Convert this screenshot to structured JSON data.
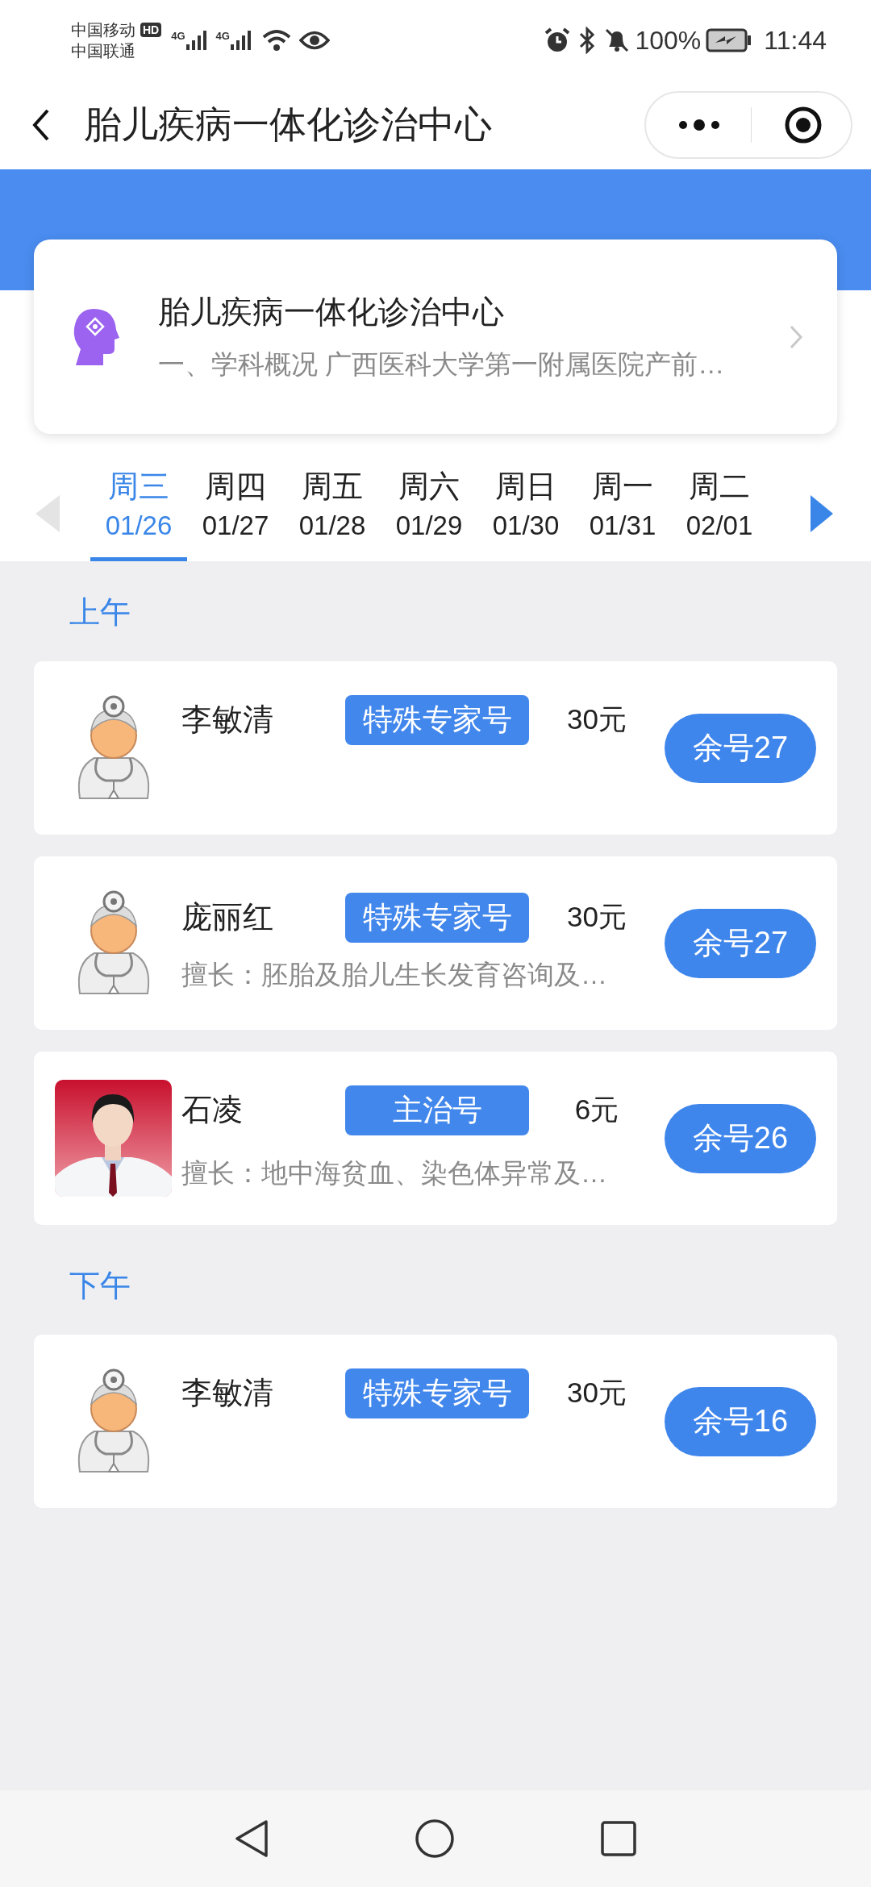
{
  "status_bar": {
    "carriers": [
      "中国移动",
      "中国联通"
    ],
    "hd_badge": "HD",
    "network_labels": [
      "4G",
      "4G"
    ],
    "battery": "100%",
    "time": "11:44"
  },
  "nav_bar": {
    "title": "胎儿疾病一体化诊治中心"
  },
  "department_card": {
    "title": "胎儿疾病一体化诊治中心",
    "description": "一、学科概况 广西医科大学第一附属医院产前…"
  },
  "days": [
    {
      "weekday": "周三",
      "date": "01/26",
      "selected": true
    },
    {
      "weekday": "周四",
      "date": "01/27",
      "selected": false
    },
    {
      "weekday": "周五",
      "date": "01/28",
      "selected": false
    },
    {
      "weekday": "周六",
      "date": "01/29",
      "selected": false
    },
    {
      "weekday": "周日",
      "date": "01/30",
      "selected": false
    },
    {
      "weekday": "周一",
      "date": "01/31",
      "selected": false
    },
    {
      "weekday": "周二",
      "date": "02/01",
      "selected": false
    }
  ],
  "sections": [
    {
      "label": "上午",
      "doctors": [
        {
          "kind": "avatar",
          "name": "李敏清",
          "tag": "特殊专家号",
          "price": "30元",
          "remaining": "余号27"
        },
        {
          "kind": "avatar",
          "name": "庞丽红",
          "tag": "特殊专家号",
          "price": "30元",
          "specialty": "擅长：胚胎及胎儿生长发育咨询及…",
          "remaining": "余号27"
        },
        {
          "name": "石凌",
          "tag": "主治号",
          "price": "6元",
          "specialty": "擅长：地中海贫血、染色体异常及…",
          "remaining": "余号26"
        }
      ]
    },
    {
      "label": "下午",
      "doctors": [
        {
          "kind": "avatar",
          "name": "李敏清",
          "tag": "特殊专家号",
          "price": "30元",
          "remaining": "余号16"
        }
      ]
    }
  ]
}
